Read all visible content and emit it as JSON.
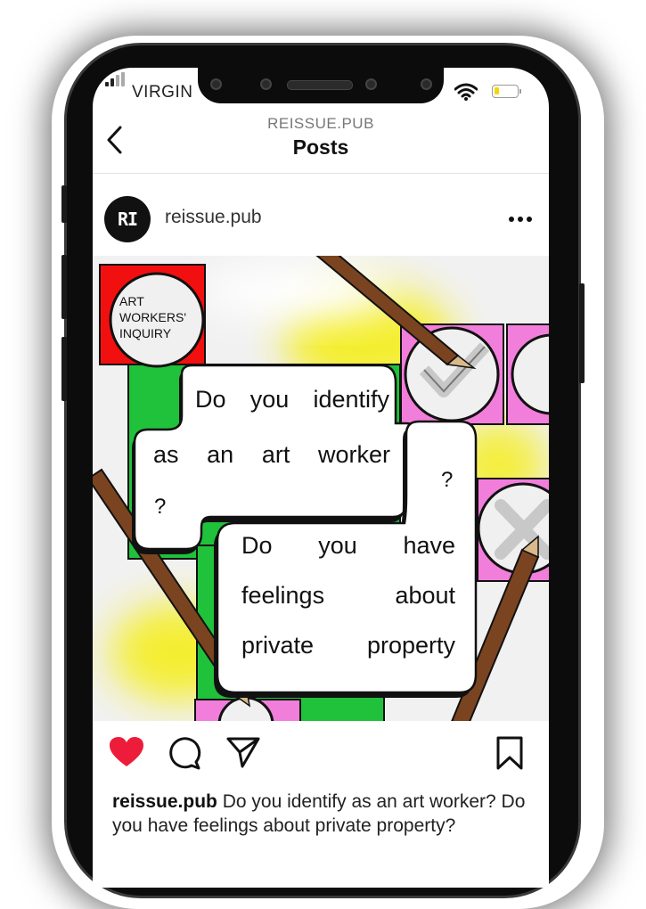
{
  "status_bar": {
    "carrier": "VIRGIN"
  },
  "nav": {
    "subtitle": "REISSUE.PUB",
    "title": "Posts"
  },
  "post": {
    "avatar_text": "RI",
    "username": "reissue.pub",
    "image": {
      "badge_text": [
        "ART",
        "WORKERS'",
        "INQUIRY"
      ],
      "bubble1": {
        "line1": "Do you identify",
        "line2": "as an art worker",
        "question_mark_left": "?",
        "question_mark_right": "?"
      },
      "bubble2": {
        "line1": "Do you have",
        "line2": "feelings about",
        "line3": "private property"
      }
    },
    "caption_user": "reissue.pub",
    "caption_text": "Do you identify as an art worker? Do you have feelings about private property?"
  },
  "colors": {
    "like_red": "#ed1c3a",
    "badge_red": "#f20f0f",
    "frame_green": "#1fc23a",
    "tile_pink": "#f27edb",
    "highlight_yellow": "#f5ee1a",
    "pencil_brown": "#7a4420"
  },
  "icons": [
    "back-chevron-icon",
    "more-dots-icon",
    "heart-icon",
    "comment-icon",
    "share-icon",
    "bookmark-icon",
    "wifi-icon",
    "battery-icon",
    "signal-icon",
    "checkmark-icon",
    "x-mark-icon",
    "pencil-icon"
  ]
}
